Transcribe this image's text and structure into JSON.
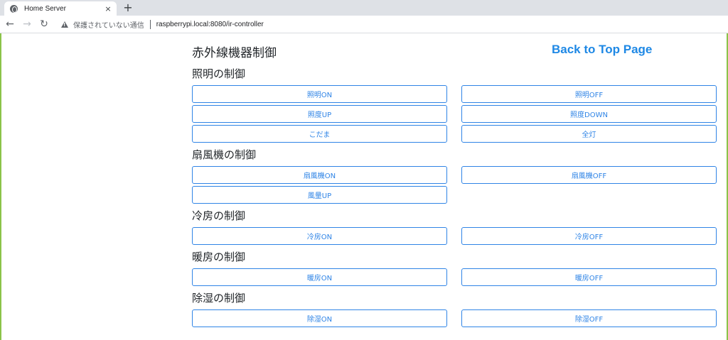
{
  "browser": {
    "tab_title": "Home Server",
    "tab_close": "×",
    "new_tab": "+",
    "back": "←",
    "forward": "→",
    "reload": "↻",
    "security_text": "保護されていない通信",
    "url": "raspberrypi.local:8080/ir-controller"
  },
  "page": {
    "title": "赤外線機器制御",
    "back_link": "Back to Top Page"
  },
  "sections": {
    "light": {
      "title": "照明の制御",
      "on": "照明ON",
      "off": "照明OFF",
      "up": "照度UP",
      "down": "照度DOWN",
      "night": "こだま",
      "full": "全灯"
    },
    "fan": {
      "title": "扇風機の制御",
      "on": "扇風機ON",
      "off": "扇風機OFF",
      "wind_up": "風量UP"
    },
    "cool": {
      "title": "冷房の制御",
      "on": "冷房ON",
      "off": "冷房OFF"
    },
    "heat": {
      "title": "暖房の制御",
      "on": "暖房ON",
      "off": "暖房OFF"
    },
    "dehumid": {
      "title": "除湿の制御",
      "on": "除湿ON",
      "off": "除湿OFF"
    }
  }
}
